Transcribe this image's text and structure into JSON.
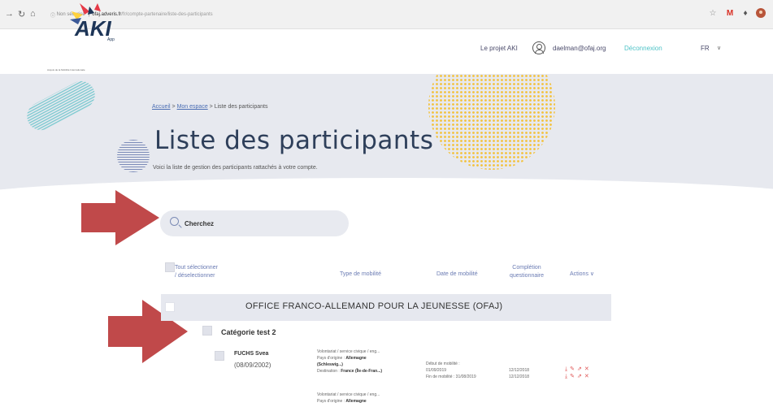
{
  "browser": {
    "security_label": "Non sécurisé",
    "url_host": "ofaj.adveris.fr",
    "url_path": "/fr/compte-partenaire/liste-des-participants"
  },
  "header": {
    "logo_text": "AKI",
    "logo_sub": "App",
    "logo_caption": "Acquis de la Mobilité Internationale",
    "projet_link": "Le projet AKI",
    "user_email": "daelman@ofaj.org",
    "logout_label": "Déconnexion",
    "language": "FR"
  },
  "hero": {
    "breadcrumb": {
      "home": "Accueil",
      "space": "Mon espace",
      "current": "Liste des participants",
      "sep": ">"
    },
    "title": "Liste des participants",
    "subtitle": "Voici la liste de gestion des participants rattachés à votre compte."
  },
  "search": {
    "placeholder": "Cherchez"
  },
  "table": {
    "select_all_line1": "Tout sélectionner",
    "select_all_line2": "/ déselectionner",
    "col_type": "Type de mobilité",
    "col_date": "Date de mobilité",
    "col_completion_line1": "Complétion",
    "col_completion_line2": "questionnaire",
    "col_actions": "Actions"
  },
  "org": {
    "name": "OFFICE FRANCO-ALLEMAND POUR LA JEUNESSE (OFAJ)"
  },
  "category": {
    "name": "Catégorie test 2"
  },
  "participants": [
    {
      "name": "FUCHS Svea",
      "birth": "(08/09/2002)",
      "type_line1": "Volontariat / service civique / eng...",
      "type_origin_label": "Pays d'origine :",
      "type_origin": "Allemagne",
      "type_region": "(Schleswig...)",
      "type_dest_label": "Destination :",
      "type_dest": "France (Île-de-Fran...)",
      "date_start": "Début de mobilité :",
      "date_start_val": "01/09/2019",
      "date_end": "Fin de mobilité : 31/08/2019",
      "completion_1": "12/12/2018",
      "completion_2": "12/12/2018"
    },
    {
      "type_line1": "Volontariat / service civique / eng...",
      "type_origin_label": "Pays d'origine :",
      "type_origin": "Allemagne"
    }
  ]
}
